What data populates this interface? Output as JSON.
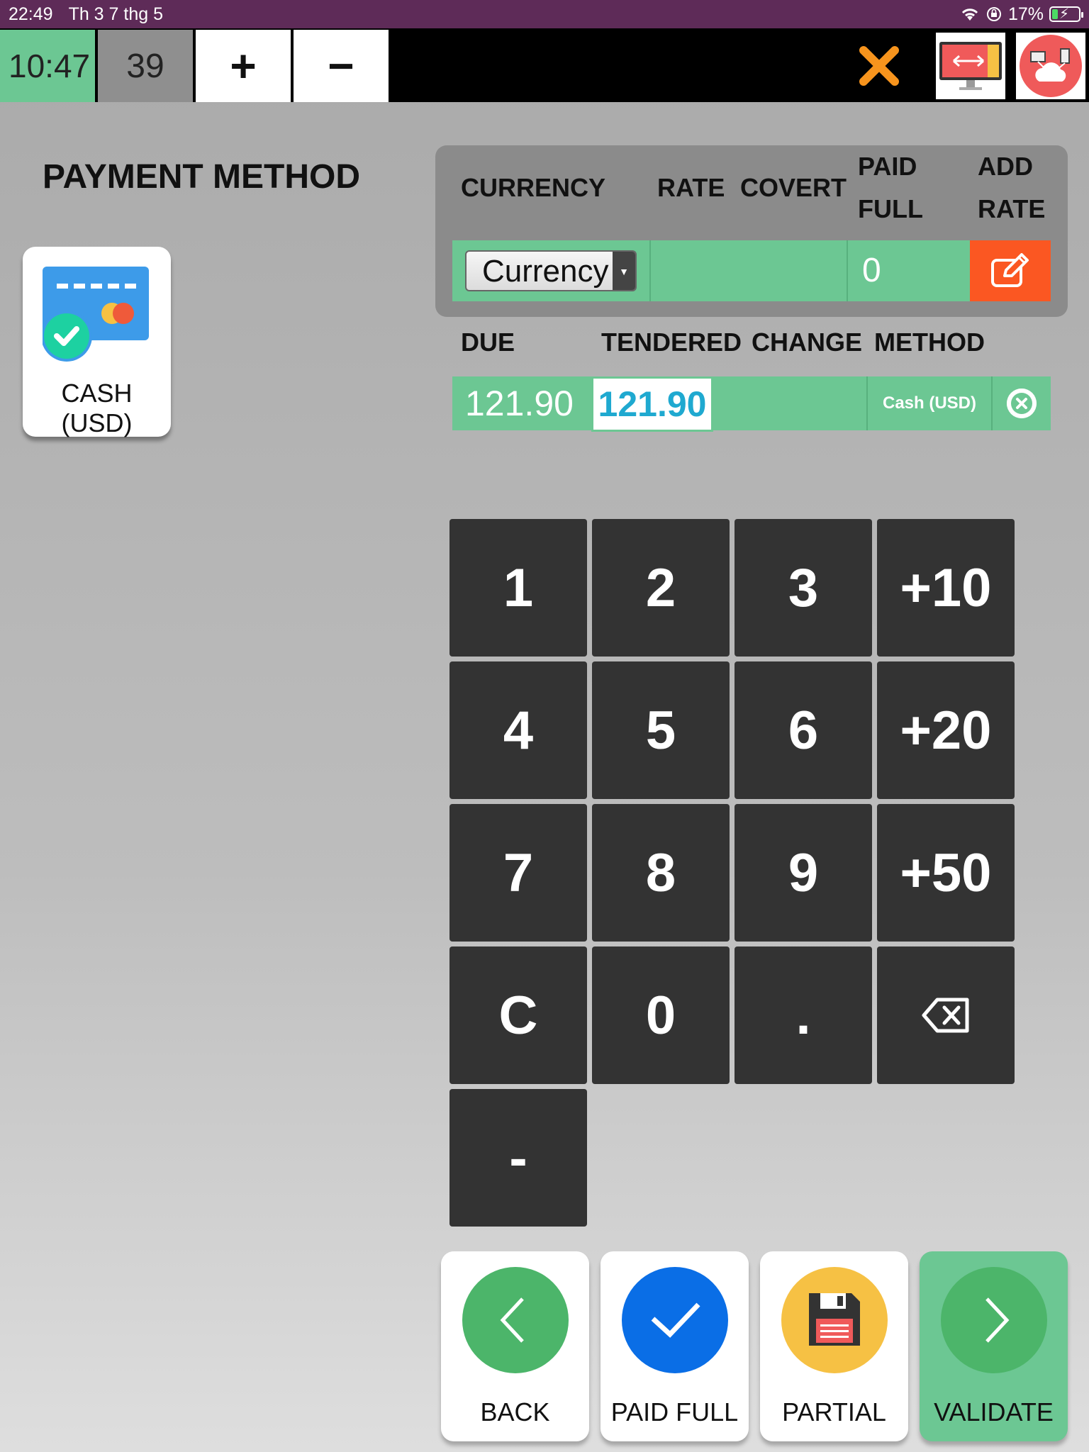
{
  "status_bar": {
    "time": "22:49",
    "date": "Th 3 7 thg 5",
    "battery": "17%"
  },
  "toolbar": {
    "clock": "10:47",
    "count": "39",
    "plus_label": "+",
    "minus_label": "−",
    "close_label": "✕"
  },
  "page": {
    "title": "PAYMENT METHOD"
  },
  "method_card": {
    "label": "CASH (USD)"
  },
  "currency_panel": {
    "headers": {
      "currency": "CURRENCY",
      "rate": "RATE",
      "covert": "COVERT",
      "paid_full_1": "PAID",
      "paid_full_2": "FULL",
      "add_rate_1": "ADD",
      "add_rate_2": "RATE"
    },
    "select_value": "Currency",
    "paid_full_value": "0"
  },
  "payment_lines": {
    "headers": {
      "due": "DUE",
      "tendered": "TENDERED",
      "change": "CHANGE",
      "method": "METHOD"
    },
    "row": {
      "due": "121.90",
      "tendered": "121.90",
      "change": "",
      "method": "Cash (USD)"
    }
  },
  "numpad": {
    "k1": "1",
    "k2": "2",
    "k3": "3",
    "k10": "+10",
    "k4": "4",
    "k5": "5",
    "k6": "6",
    "k20": "+20",
    "k7": "7",
    "k8": "8",
    "k9": "9",
    "k50": "+50",
    "kc": "C",
    "k0": "0",
    "kdot": ".",
    "kneg": "-"
  },
  "actions": {
    "back": "BACK",
    "paid_full": "PAID FULL",
    "partial": "PARTIAL",
    "validate": "VALIDATE"
  },
  "colors": {
    "green": "#6cc793",
    "orange": "#fb5722",
    "blue": "#0a6ee6",
    "yellow": "#f6c144",
    "status": "#5e2b58"
  }
}
